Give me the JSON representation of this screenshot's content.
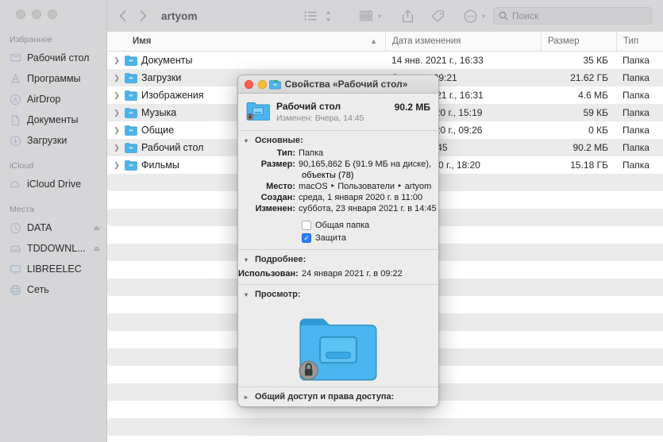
{
  "finder": {
    "window_controls": [
      "close",
      "minimize",
      "zoom"
    ],
    "toolbar": {
      "back_icon": "chevron-left-icon",
      "forward_icon": "chevron-right-icon",
      "title": "artyom",
      "view_list_icon": "list-view-icon",
      "view_sort_icon": "sort-updown-icon",
      "group_icon": "group-by-icon",
      "share_icon": "share-icon",
      "tag_icon": "tag-icon",
      "more_icon": "ellipsis-circle-icon",
      "caret_icon": "chevron-down-icon"
    },
    "search": {
      "placeholder": "Поиск",
      "value": "",
      "icon": "search-icon"
    },
    "sidebar": {
      "groups": [
        {
          "title": "Избранное",
          "items": [
            {
              "label": "Рабочий стол",
              "icon": "desktop-icon",
              "eject": false
            },
            {
              "label": "Программы",
              "icon": "applications-icon",
              "eject": false
            },
            {
              "label": "AirDrop",
              "icon": "airdrop-icon",
              "eject": false
            },
            {
              "label": "Документы",
              "icon": "documents-icon",
              "eject": false
            },
            {
              "label": "Загрузки",
              "icon": "downloads-icon",
              "eject": false
            }
          ]
        },
        {
          "title": "iCloud",
          "items": [
            {
              "label": "iCloud Drive",
              "icon": "cloud-icon",
              "eject": false
            }
          ]
        },
        {
          "title": "Места",
          "items": [
            {
              "label": "DATA",
              "icon": "disk-icon",
              "eject": true
            },
            {
              "label": "TDDOWNL...",
              "icon": "external-disk-icon",
              "eject": true
            },
            {
              "label": "LIBREELEC",
              "icon": "display-icon",
              "eject": false
            },
            {
              "label": "Сеть",
              "icon": "network-globe-icon",
              "eject": false
            }
          ]
        }
      ]
    },
    "columns": {
      "name": "Имя",
      "date_modified": "Дата изменения",
      "size": "Размер",
      "kind": "Тип",
      "sort_arrow": "chevron-up-icon"
    },
    "rows": [
      {
        "name": "Документы",
        "date": "14 янв. 2021 г., 16:33",
        "size": "35 КБ",
        "kind": "Папка"
      },
      {
        "name": "Загрузки",
        "date": "Сегодня, 09:21",
        "size": "21.62 ГБ",
        "kind": "Папка"
      },
      {
        "name": "Изображения",
        "date": "14 янв. 2021 г., 16:31",
        "size": "4.6 МБ",
        "kind": "Папка"
      },
      {
        "name": "Музыка",
        "date": "20 мая 2020 г., 15:19",
        "size": "59 КБ",
        "kind": "Папка"
      },
      {
        "name": "Общие",
        "date": "13 мая 2020 г., 09:26",
        "size": "0 КБ",
        "kind": "Папка"
      },
      {
        "name": "Рабочий стол",
        "date": "Вчера, 14:45",
        "size": "90.2 МБ",
        "kind": "Папка"
      },
      {
        "name": "Фильмы",
        "date": "3 июн. 2020 г., 18:20",
        "size": "15.18 ГБ",
        "kind": "Папка"
      }
    ]
  },
  "info_window": {
    "title": "Свойства «Рабочий стол»",
    "title_icon": "desktop-folder-icon",
    "window_controls": [
      "close",
      "minimize",
      "zoom"
    ],
    "header": {
      "icon": "desktop-folder-locked-icon",
      "name": "Рабочий стол",
      "modified_label": "Изменен: Вчера, 14:45",
      "size": "90.2 МБ"
    },
    "general": {
      "header": "Основные:",
      "disclosure": "expanded",
      "fields": [
        {
          "key": "Тип:",
          "value": "Папка"
        },
        {
          "key": "Размер:",
          "value": "90,165,862 Б (91.9 МБ на диске),",
          "value2": "объекты (78)"
        },
        {
          "key": "Место:",
          "value": "macOS ‣ Пользователи ‣ artyom"
        },
        {
          "key": "Создан:",
          "value": "среда, 1 января 2020 г. в 11:00"
        },
        {
          "key": "Изменен:",
          "value": "суббота, 23 января 2021 г. в 14:45"
        }
      ],
      "checkboxes": [
        {
          "label": "Общая папка",
          "checked": false
        },
        {
          "label": "Защита",
          "checked": true
        }
      ]
    },
    "more": {
      "header": "Подробнее:",
      "disclosure": "expanded",
      "fields": [
        {
          "key": "Использован:",
          "value": "24 января 2021 г. в 09:22"
        }
      ]
    },
    "preview": {
      "header": "Просмотр:",
      "disclosure": "expanded",
      "icon": "desktop-folder-locked-large-icon"
    },
    "sharing": {
      "header": "Общий доступ и права доступа:",
      "disclosure": "collapsed"
    }
  },
  "colors": {
    "accent": "#2d7ff9",
    "folder_blue": "#4bb5ef",
    "sidebar_bg": "#d6d6d8",
    "toolbar_bg": "#d6d6d8",
    "dialog_bg": "#ececec",
    "row_alt": "#ebebec"
  }
}
